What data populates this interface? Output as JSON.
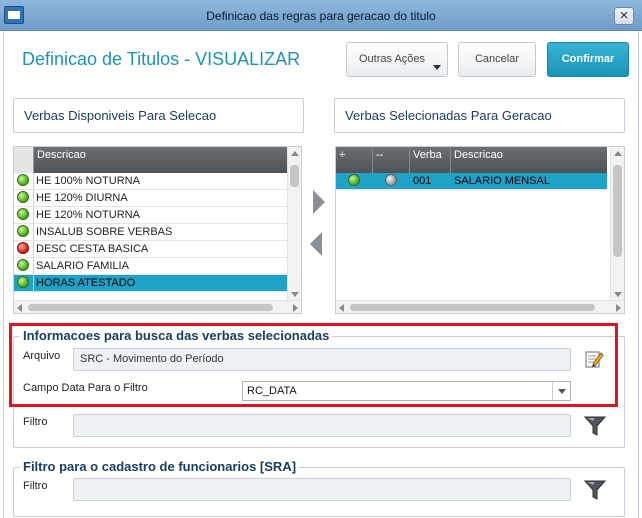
{
  "window": {
    "title": "Definicao das regras para geracao do titulo",
    "close_label": "×"
  },
  "header": {
    "title": "Definicao de Titulos - VISUALIZAR",
    "buttons": {
      "other_actions": "Outras Ações",
      "cancel": "Cancelar",
      "confirm": "Confirmar"
    }
  },
  "available": {
    "title": "Verbas Disponiveis Para Selecao",
    "column": "Descricao",
    "rows": [
      {
        "status": "green",
        "description": "HE 100% NOTURNA"
      },
      {
        "status": "green",
        "description": "HE 120% DIURNA"
      },
      {
        "status": "green",
        "description": "HE 120% NOTURNA"
      },
      {
        "status": "green",
        "description": "INSALUB SOBRE VERBAS"
      },
      {
        "status": "red",
        "description": "DESC CESTA BASICA"
      },
      {
        "status": "green",
        "description": "SALARIO FAMILIA"
      },
      {
        "status": "green",
        "description": "HORAS ATESTADO"
      }
    ]
  },
  "selected": {
    "title": "Verbas Selecionadas Para Geracao",
    "columns": {
      "plus": "+",
      "minus": "--",
      "verba": "Verba",
      "descricao": "Descricao"
    },
    "rows": [
      {
        "status1": "green",
        "status2": "gray",
        "verba": "001",
        "description": "SALARIO MENSAL"
      }
    ]
  },
  "busca": {
    "legend": "Informacoes para busca das verbas selecionadas",
    "arquivo_label": "Arquivo",
    "arquivo_value": "SRC - Movimento do Período",
    "campo_label": "Campo Data Para o Filtro",
    "campo_value": "RC_DATA",
    "filtro_label": "Filtro",
    "filtro_value": ""
  },
  "cadastro": {
    "legend": "Filtro para o cadastro de funcionarios [SRA]",
    "filtro_label": "Filtro",
    "filtro_value": ""
  },
  "colors": {
    "accent": "#1b94b9",
    "selected_row": "#1ea2c7",
    "highlight_box": "#e0141e"
  }
}
